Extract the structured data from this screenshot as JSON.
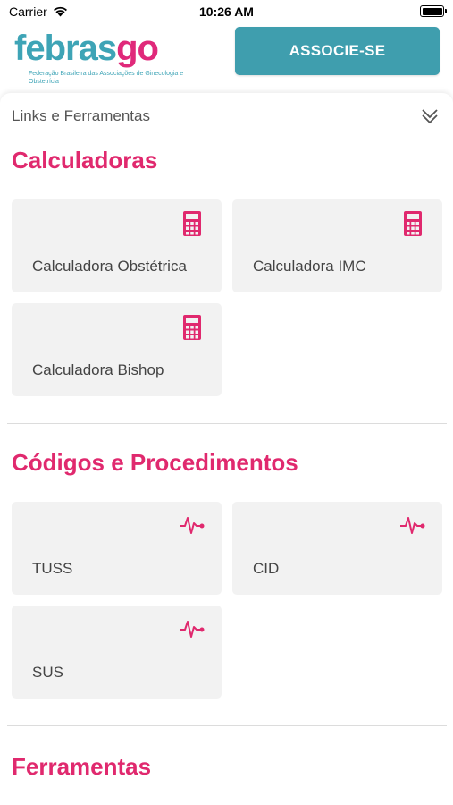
{
  "status_bar": {
    "carrier": "Carrier",
    "time": "10:26 AM"
  },
  "header": {
    "logo_text_part1": "febras",
    "logo_text_part2": "go",
    "logo_subtitle": "Federação Brasileira das Associações de Ginecologia e Obstetrícia",
    "associe_button": "ASSOCIE-SE"
  },
  "panel": {
    "title": "Links e Ferramentas"
  },
  "sections": [
    {
      "title": "Calculadoras",
      "cards": [
        {
          "label": "Calculadora Obstétrica",
          "icon": "calculator-icon"
        },
        {
          "label": "Calculadora IMC",
          "icon": "calculator-icon"
        },
        {
          "label": "Calculadora Bishop",
          "icon": "calculator-icon"
        }
      ]
    },
    {
      "title": "Códigos e Procedimentos",
      "cards": [
        {
          "label": "TUSS",
          "icon": "pulse-icon"
        },
        {
          "label": "CID",
          "icon": "pulse-icon"
        },
        {
          "label": "SUS",
          "icon": "pulse-icon"
        }
      ]
    },
    {
      "title": "Ferramentas",
      "cards": []
    }
  ],
  "colors": {
    "accent_pink": "#e0296e",
    "brand_teal": "#3f9eae",
    "card_bg": "#f2f2f2"
  }
}
